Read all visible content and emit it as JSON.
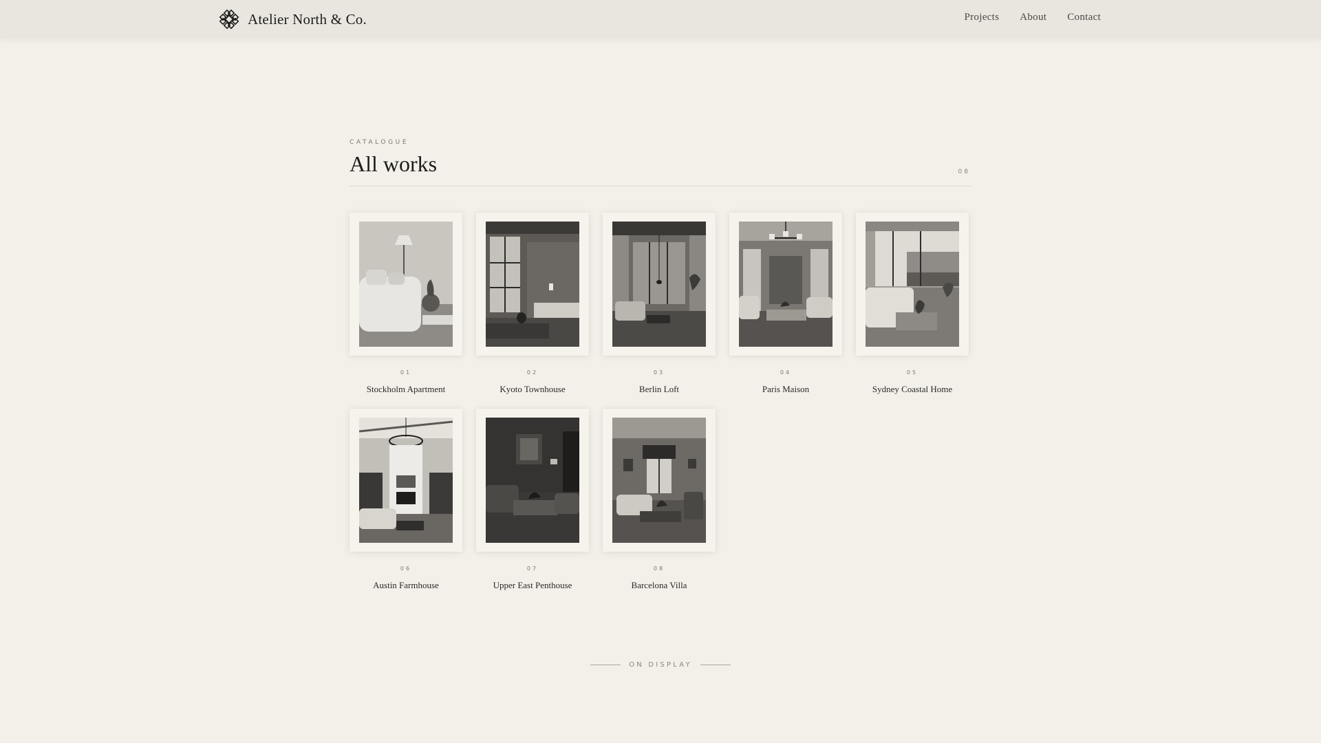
{
  "header": {
    "brand_name": "Atelier North & Co.",
    "logo_icon": "knot-ornament-icon",
    "nav": [
      {
        "label": "Projects"
      },
      {
        "label": "About"
      },
      {
        "label": "Contact"
      }
    ]
  },
  "catalogue": {
    "eyebrow": "CATALOGUE",
    "title": "All works",
    "count": "08"
  },
  "works": [
    {
      "num": "01",
      "title": "Stockholm Apartment"
    },
    {
      "num": "02",
      "title": "Kyoto Townhouse"
    },
    {
      "num": "03",
      "title": "Berlin Loft"
    },
    {
      "num": "04",
      "title": "Paris Maison"
    },
    {
      "num": "05",
      "title": "Sydney Coastal Home"
    },
    {
      "num": "06",
      "title": "Austin Farmhouse"
    },
    {
      "num": "07",
      "title": "Upper East Penthouse"
    },
    {
      "num": "08",
      "title": "Barcelona Villa"
    }
  ],
  "footer": {
    "ondisplay_label": "ON DISPLAY"
  }
}
